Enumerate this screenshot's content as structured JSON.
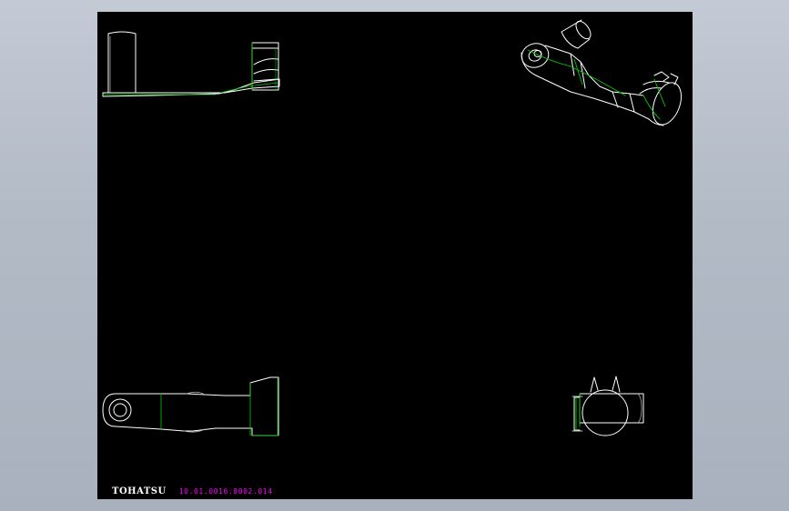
{
  "drawing_sheet": {
    "background_color": "#000000",
    "line_color": "#ffffff",
    "hidden_line_color": "#00c800",
    "views": [
      {
        "name": "front-view"
      },
      {
        "name": "isometric-view"
      },
      {
        "name": "top-view"
      },
      {
        "name": "side-view"
      }
    ]
  },
  "title_block": {
    "company": "TOHATSU",
    "drawing_number": "10.01.0016.8002.014",
    "drawing_number_color": "#ff00ff"
  }
}
